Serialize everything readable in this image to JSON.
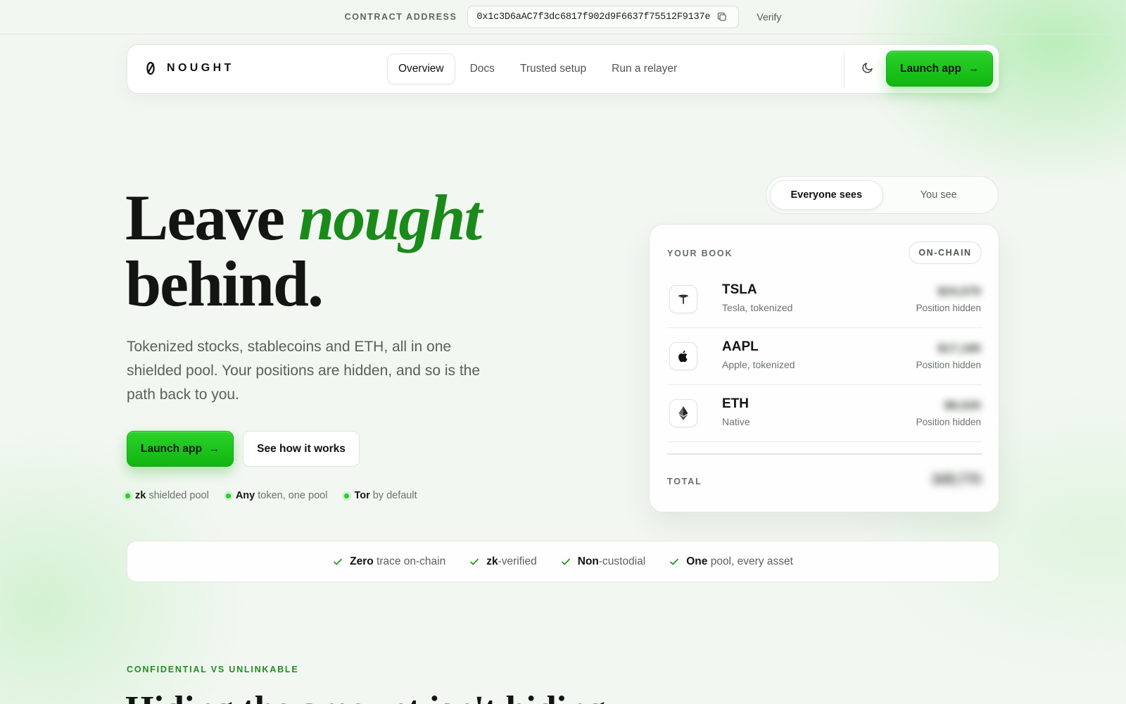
{
  "contract_bar": {
    "label": "CONTRACT ADDRESS",
    "address": "0x1c3D6aAC7f3dc6817f902d9F6637f75512F9137e",
    "copy_icon": "copy-icon",
    "verify_label": "Verify"
  },
  "nav": {
    "brand": "NOUGHT",
    "brand_icon": "nought-logo-icon",
    "links": [
      "Overview",
      "Docs",
      "Trusted setup",
      "Run a relayer"
    ],
    "active_link": "Overview",
    "theme_icon": "moon-icon",
    "launch_label": "Launch app",
    "arrow": "→"
  },
  "hero": {
    "title_line1_plain": "Leave ",
    "title_line1_accent": "nought",
    "title_line2": "behind.",
    "subtitle": "Tokenized stocks, stablecoins and ETH, all in one shielded pool. Your positions are hidden, and so is the path back to you.",
    "primary_cta": "Launch app",
    "secondary_cta": "See how it works",
    "tags": [
      {
        "bold": "zk",
        "rest": " shielded pool"
      },
      {
        "bold": "Any",
        "rest": " token, one pool"
      },
      {
        "bold": "Tor",
        "rest": " by default"
      }
    ]
  },
  "view_toggle": {
    "options": [
      "Everyone sees",
      "You see"
    ],
    "selected": "Everyone sees"
  },
  "book": {
    "title": "YOUR BOOK",
    "badge": "ON-CHAIN",
    "assets": [
      {
        "symbol": "TSLA",
        "desc": "Tesla, tokenized",
        "status": "Position hidden",
        "icon": "tesla-icon",
        "blurred": "$24,570"
      },
      {
        "symbol": "AAPL",
        "desc": "Apple, tokenized",
        "status": "Position hidden",
        "icon": "apple-icon",
        "blurred": "$17,180"
      },
      {
        "symbol": "ETH",
        "desc": "Native",
        "status": "Position hidden",
        "icon": "ethereum-icon",
        "blurred": "$8,020"
      }
    ],
    "total_label": "TOTAL",
    "total_blurred": "$49,770"
  },
  "features": [
    {
      "bold": "Zero",
      "rest": " trace on-chain"
    },
    {
      "bold": "zk",
      "rest": "-verified"
    },
    {
      "bold": "Non",
      "rest": "-custodial"
    },
    {
      "bold": "One",
      "rest": " pool, every asset"
    }
  ],
  "next_section": {
    "eyebrow": "CONFIDENTIAL VS UNLINKABLE",
    "title": "Hiding the amount isn't hiding"
  },
  "colors": {
    "accent_green": "#1a8a1a",
    "cta_green": "#22c422",
    "background": "#f3f7f2"
  }
}
